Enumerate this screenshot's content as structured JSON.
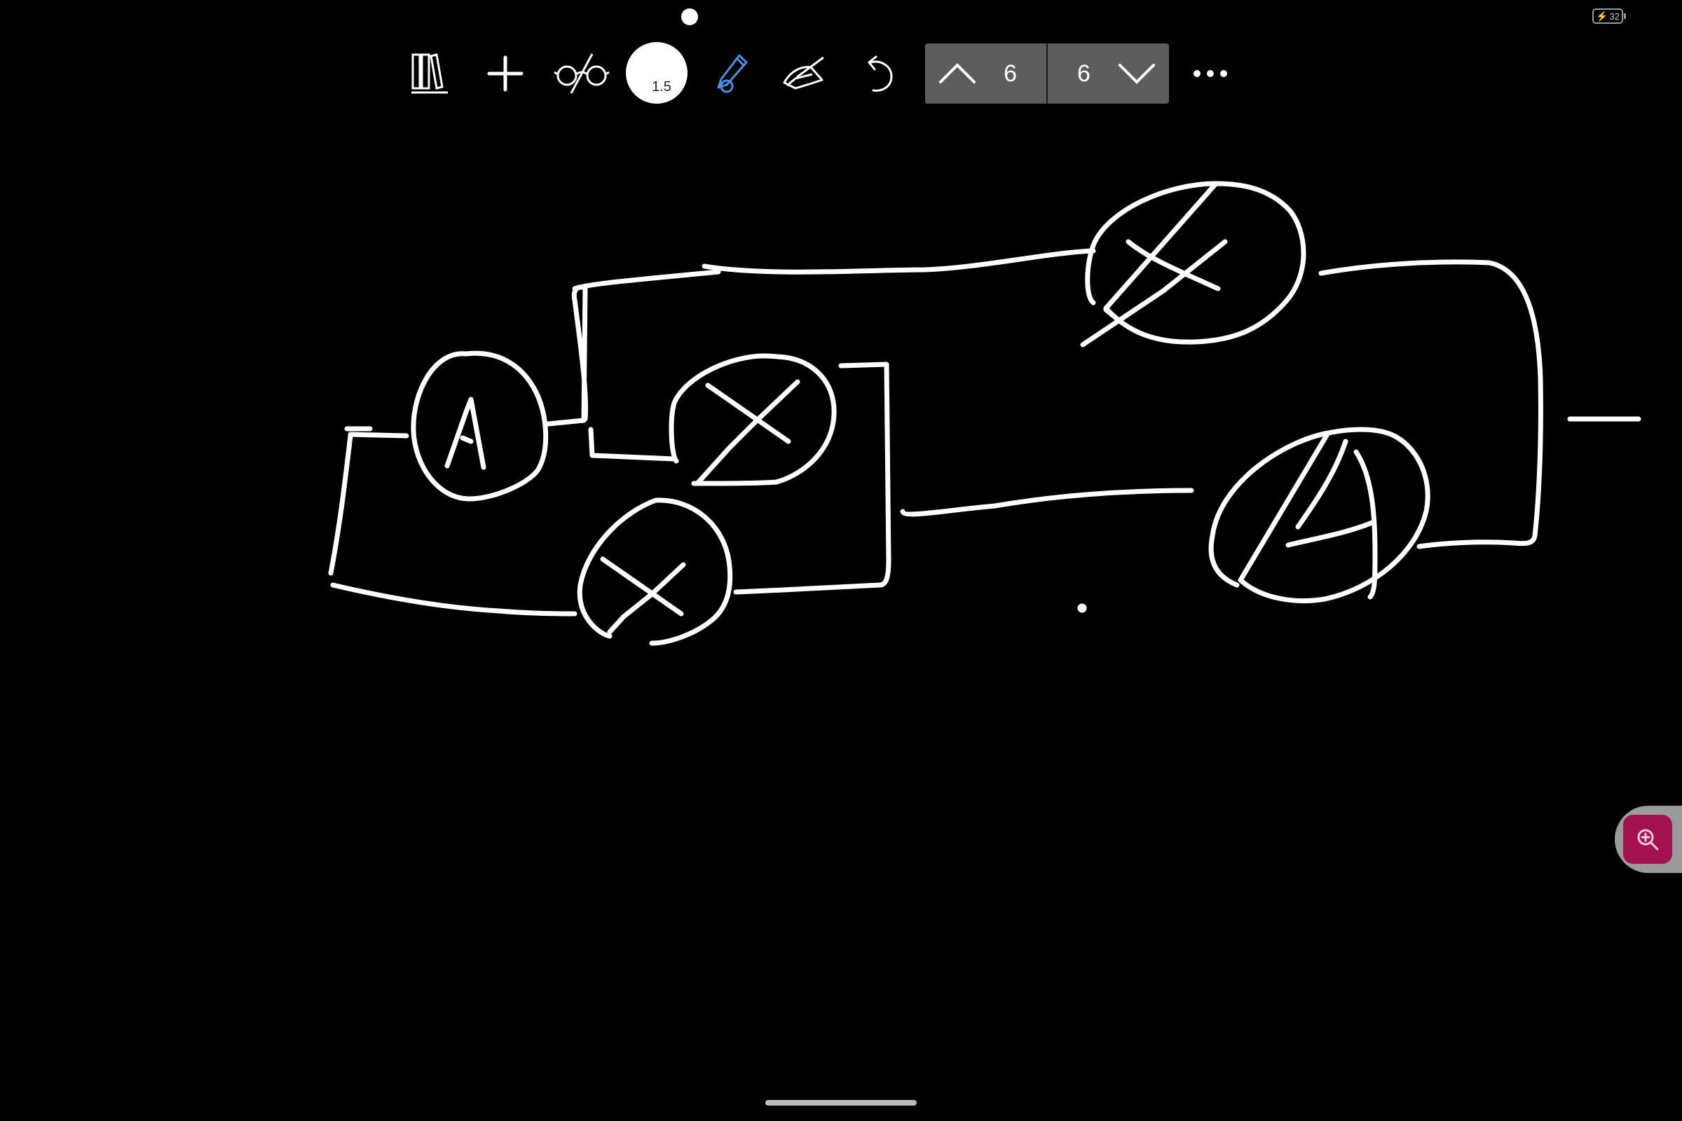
{
  "status_bar": {
    "battery_level": "32",
    "battery_charging_icon": "bolt-icon"
  },
  "toolbar": {
    "library_icon": "library-books-icon",
    "add_icon": "plus-icon",
    "view_icon": "glasses-icon",
    "pen_size": "1.5",
    "pen_icon": "pen-icon",
    "highlighter_icon": "highlighter-icon",
    "undo_icon": "undo-icon",
    "more_icon": "more-horizontal-icon"
  },
  "pager": {
    "prev_icon": "chevron-up-icon",
    "current_page": "6",
    "total_pages": "6",
    "next_icon": "chevron-down-icon"
  },
  "zoom": {
    "icon": "zoom-in-icon",
    "color": "#a3124f"
  },
  "colors": {
    "background": "#000000",
    "ink": "#ffffff",
    "pager_bg": "#5d5d5d",
    "pen_accent": "#4a90e2"
  }
}
